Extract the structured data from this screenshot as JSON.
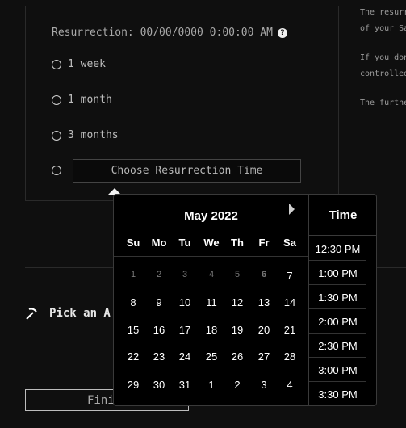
{
  "resurrection": {
    "title": "Resurrection: 00/00/0000 0:00:00 AM",
    "help_glyph": "?",
    "options": [
      "1 week",
      "1 month",
      "3 months"
    ],
    "choose_label": "Choose Resurrection Time"
  },
  "side_text": {
    "line1": "The resurre",
    "line2": "of your Sa",
    "line3": "If you don",
    "line4": "controlled",
    "line5": "The further"
  },
  "pick": {
    "label": "Pick an A",
    "icon": "pickaxe-icon"
  },
  "finish": {
    "label": "Fini"
  },
  "calendar": {
    "month": "May 2022",
    "weekdays": [
      "Su",
      "Mo",
      "Tu",
      "We",
      "Th",
      "Fr",
      "Sa"
    ],
    "weeks": [
      [
        "1",
        "2",
        "3",
        "4",
        "5",
        "6",
        "7"
      ],
      [
        "8",
        "9",
        "10",
        "11",
        "12",
        "13",
        "14"
      ],
      [
        "15",
        "16",
        "17",
        "18",
        "19",
        "20",
        "21"
      ],
      [
        "22",
        "23",
        "24",
        "25",
        "26",
        "27",
        "28"
      ],
      [
        "29",
        "30",
        "31",
        "1",
        "2",
        "3",
        "4"
      ]
    ]
  },
  "time": {
    "header": "Time",
    "slots": [
      "12:30 PM",
      "1:00 PM",
      "1:30 PM",
      "2:00 PM",
      "2:30 PM",
      "3:00 PM",
      "3:30 PM"
    ]
  }
}
